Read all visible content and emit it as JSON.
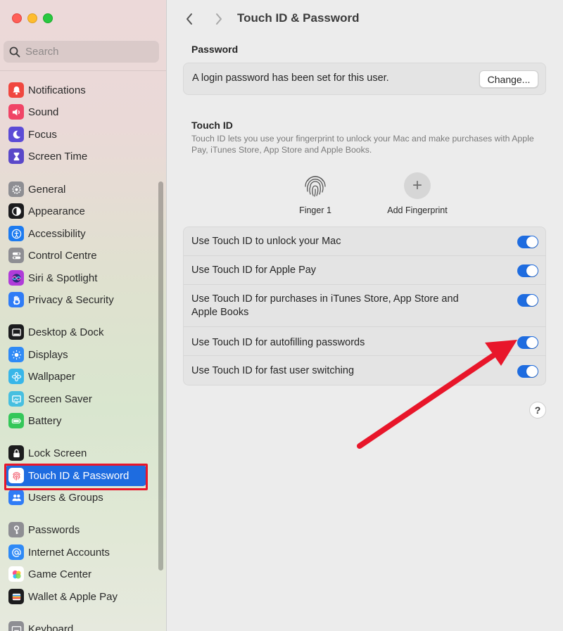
{
  "sidebar": {
    "search_placeholder": "Search",
    "items": [
      {
        "label": "Notifications",
        "icon": "bell-icon",
        "color": "#f0473f"
      },
      {
        "label": "Sound",
        "icon": "speaker-icon",
        "color": "#f04466"
      },
      {
        "label": "Focus",
        "icon": "moon-icon",
        "color": "#5c4bd6"
      },
      {
        "label": "Screen Time",
        "icon": "hourglass-icon",
        "color": "#5a48c9"
      },
      {
        "label": "General",
        "icon": "gear-icon",
        "color": "#8e8e93"
      },
      {
        "label": "Appearance",
        "icon": "appearance-icon",
        "color": "#1c1c1e"
      },
      {
        "label": "Accessibility",
        "icon": "accessibility-icon",
        "color": "#1d7bf0"
      },
      {
        "label": "Control Centre",
        "icon": "control-centre-icon",
        "color": "#8e8e93"
      },
      {
        "label": "Siri & Spotlight",
        "icon": "siri-icon",
        "color": "#b03cd9"
      },
      {
        "label": "Privacy & Security",
        "icon": "hand-icon",
        "color": "#2f7cf6"
      },
      {
        "label": "Desktop & Dock",
        "icon": "dock-icon",
        "color": "#1c1c1e"
      },
      {
        "label": "Displays",
        "icon": "sun-icon",
        "color": "#2f8af6"
      },
      {
        "label": "Wallpaper",
        "icon": "flower-icon",
        "color": "#38b6e8"
      },
      {
        "label": "Screen Saver",
        "icon": "screensaver-icon",
        "color": "#47bfe0"
      },
      {
        "label": "Battery",
        "icon": "battery-icon",
        "color": "#34c759"
      },
      {
        "label": "Lock Screen",
        "icon": "lock-icon",
        "color": "#1c1c1e"
      },
      {
        "label": "Touch ID & Password",
        "icon": "fingerprint-icon",
        "color": "#ffffff"
      },
      {
        "label": "Users & Groups",
        "icon": "users-icon",
        "color": "#2f7cf6"
      },
      {
        "label": "Passwords",
        "icon": "key-icon",
        "color": "#8e8e93"
      },
      {
        "label": "Internet Accounts",
        "icon": "at-icon",
        "color": "#2f8af6"
      },
      {
        "label": "Game Center",
        "icon": "game-center-icon",
        "color": "#ffffff"
      },
      {
        "label": "Wallet & Apple Pay",
        "icon": "wallet-icon",
        "color": "#1c1c1e"
      },
      {
        "label": "Keyboard",
        "icon": "keyboard-icon",
        "color": "#8e8e93"
      }
    ],
    "selected_index": 16
  },
  "main": {
    "title": "Touch ID & Password",
    "password_section": {
      "title": "Password",
      "text": "A login password has been set for this user.",
      "button": "Change..."
    },
    "touchid_section": {
      "title": "Touch ID",
      "description": "Touch ID lets you use your fingerprint to unlock your Mac and make purchases with Apple Pay, iTunes Store, App Store and Apple Books.",
      "finger_label": "Finger 1",
      "add_label": "Add Fingerprint"
    },
    "options": [
      {
        "label": "Use Touch ID to unlock your Mac",
        "enabled": true
      },
      {
        "label": "Use Touch ID for Apple Pay",
        "enabled": true
      },
      {
        "label": "Use Touch ID for purchases in iTunes Store, App Store and Apple Books",
        "enabled": true
      },
      {
        "label": "Use Touch ID for autofilling passwords",
        "enabled": true
      },
      {
        "label": "Use Touch ID for fast user switching",
        "enabled": true
      }
    ],
    "help": "?"
  },
  "colors": {
    "accent": "#1e6ce0",
    "annotation": "#e8162a"
  }
}
